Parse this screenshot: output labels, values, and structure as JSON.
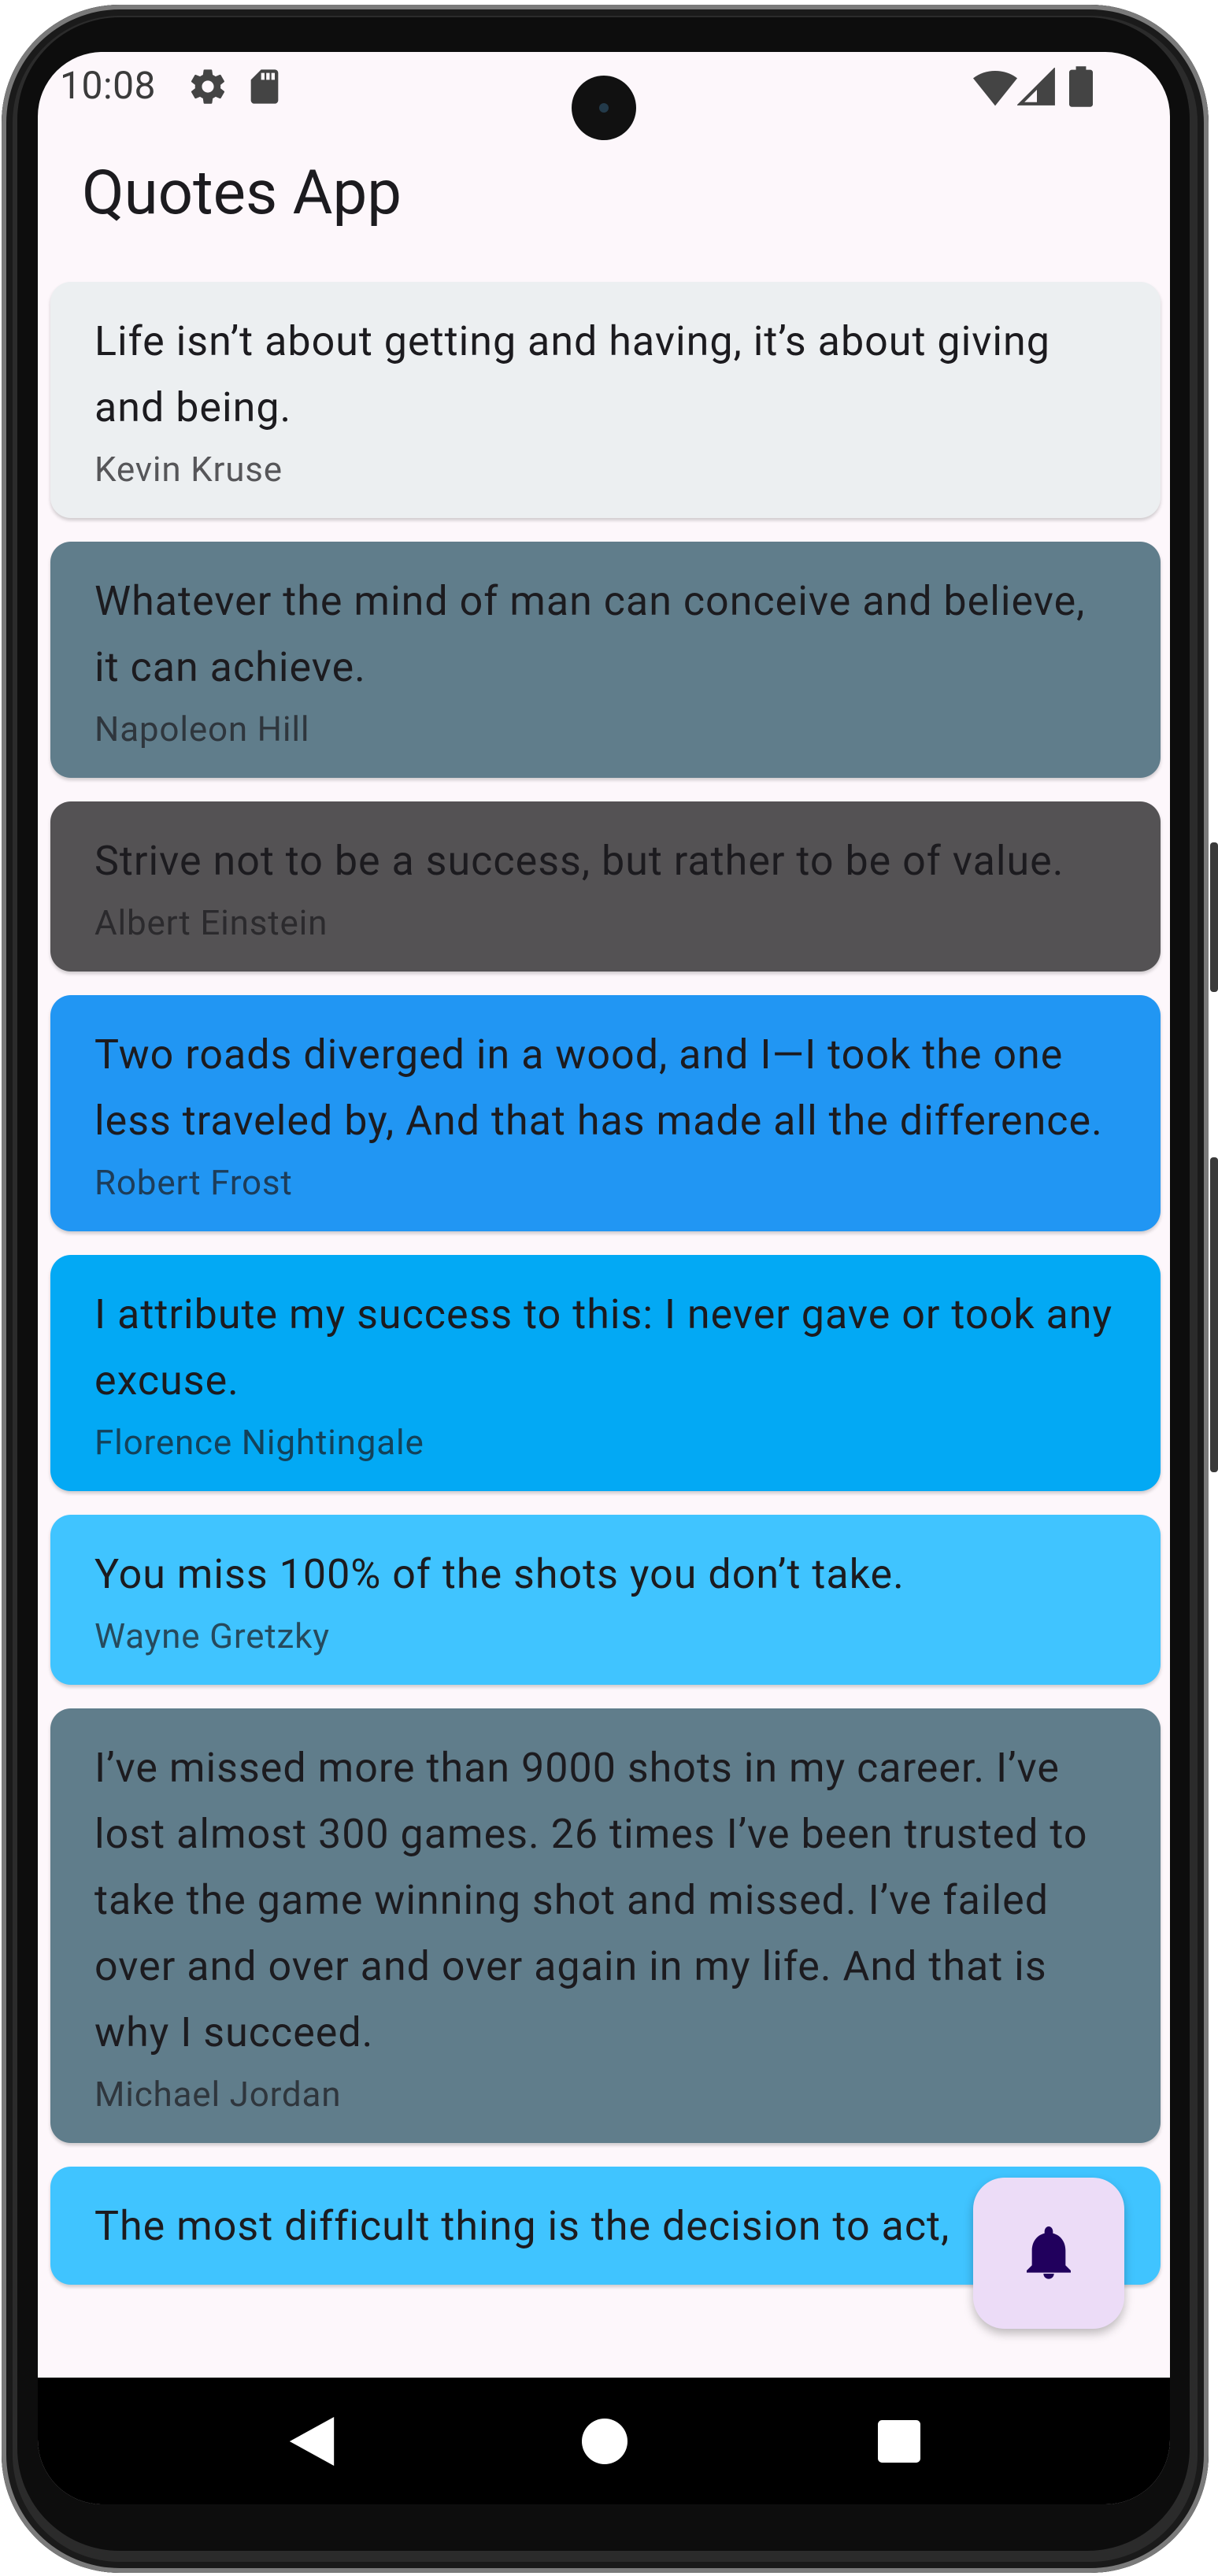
{
  "status_bar": {
    "time": "10:08",
    "left_icons": [
      "gear-icon",
      "sd-card-icon"
    ],
    "right_icons": [
      "wifi-icon",
      "cell-signal-icon",
      "battery-icon"
    ]
  },
  "app_bar": {
    "title": "Quotes App"
  },
  "quotes": [
    {
      "text": "Life isn’t about getting and having, it’s about giving and being.",
      "author": "Kevin Kruse",
      "color": "#eceff1"
    },
    {
      "text": "Whatever the mind of man can conceive and believe, it can achieve.",
      "author": "Napoleon Hill",
      "color": "#607d8b"
    },
    {
      "text": "Strive not to be a success, but rather to be of value.",
      "author": "Albert Einstein",
      "color": "#545254"
    },
    {
      "text": "Two roads diverged in a wood, and I—I took the one less traveled by, And that has made all the difference.",
      "author": "Robert Frost",
      "color": "#2196f3"
    },
    {
      "text": "I attribute my success to this: I never gave or took any excuse.",
      "author": "Florence Nightingale",
      "color": "#03a9f4"
    },
    {
      "text": "You miss 100% of the shots you don’t take.",
      "author": "Wayne Gretzky",
      "color": "#40c4ff"
    },
    {
      "text": "I’ve missed more than 9000 shots in my career. I’ve lost almost 300 games. 26 times I’ve been trusted to take the game winning shot and missed. I’ve failed over and over and over again in my life. And that is why I succeed.",
      "author": "Michael Jordan",
      "color": "#607d8b"
    },
    {
      "text": "The most difficult thing is the decision to act,",
      "author": "",
      "color": "#40c4ff"
    }
  ],
  "fab": {
    "icon": "bell-icon",
    "color": "#ecdcf7",
    "icon_color": "#21005d"
  },
  "nav_bar": {
    "buttons": [
      "back-icon",
      "home-icon",
      "recents-icon"
    ]
  }
}
